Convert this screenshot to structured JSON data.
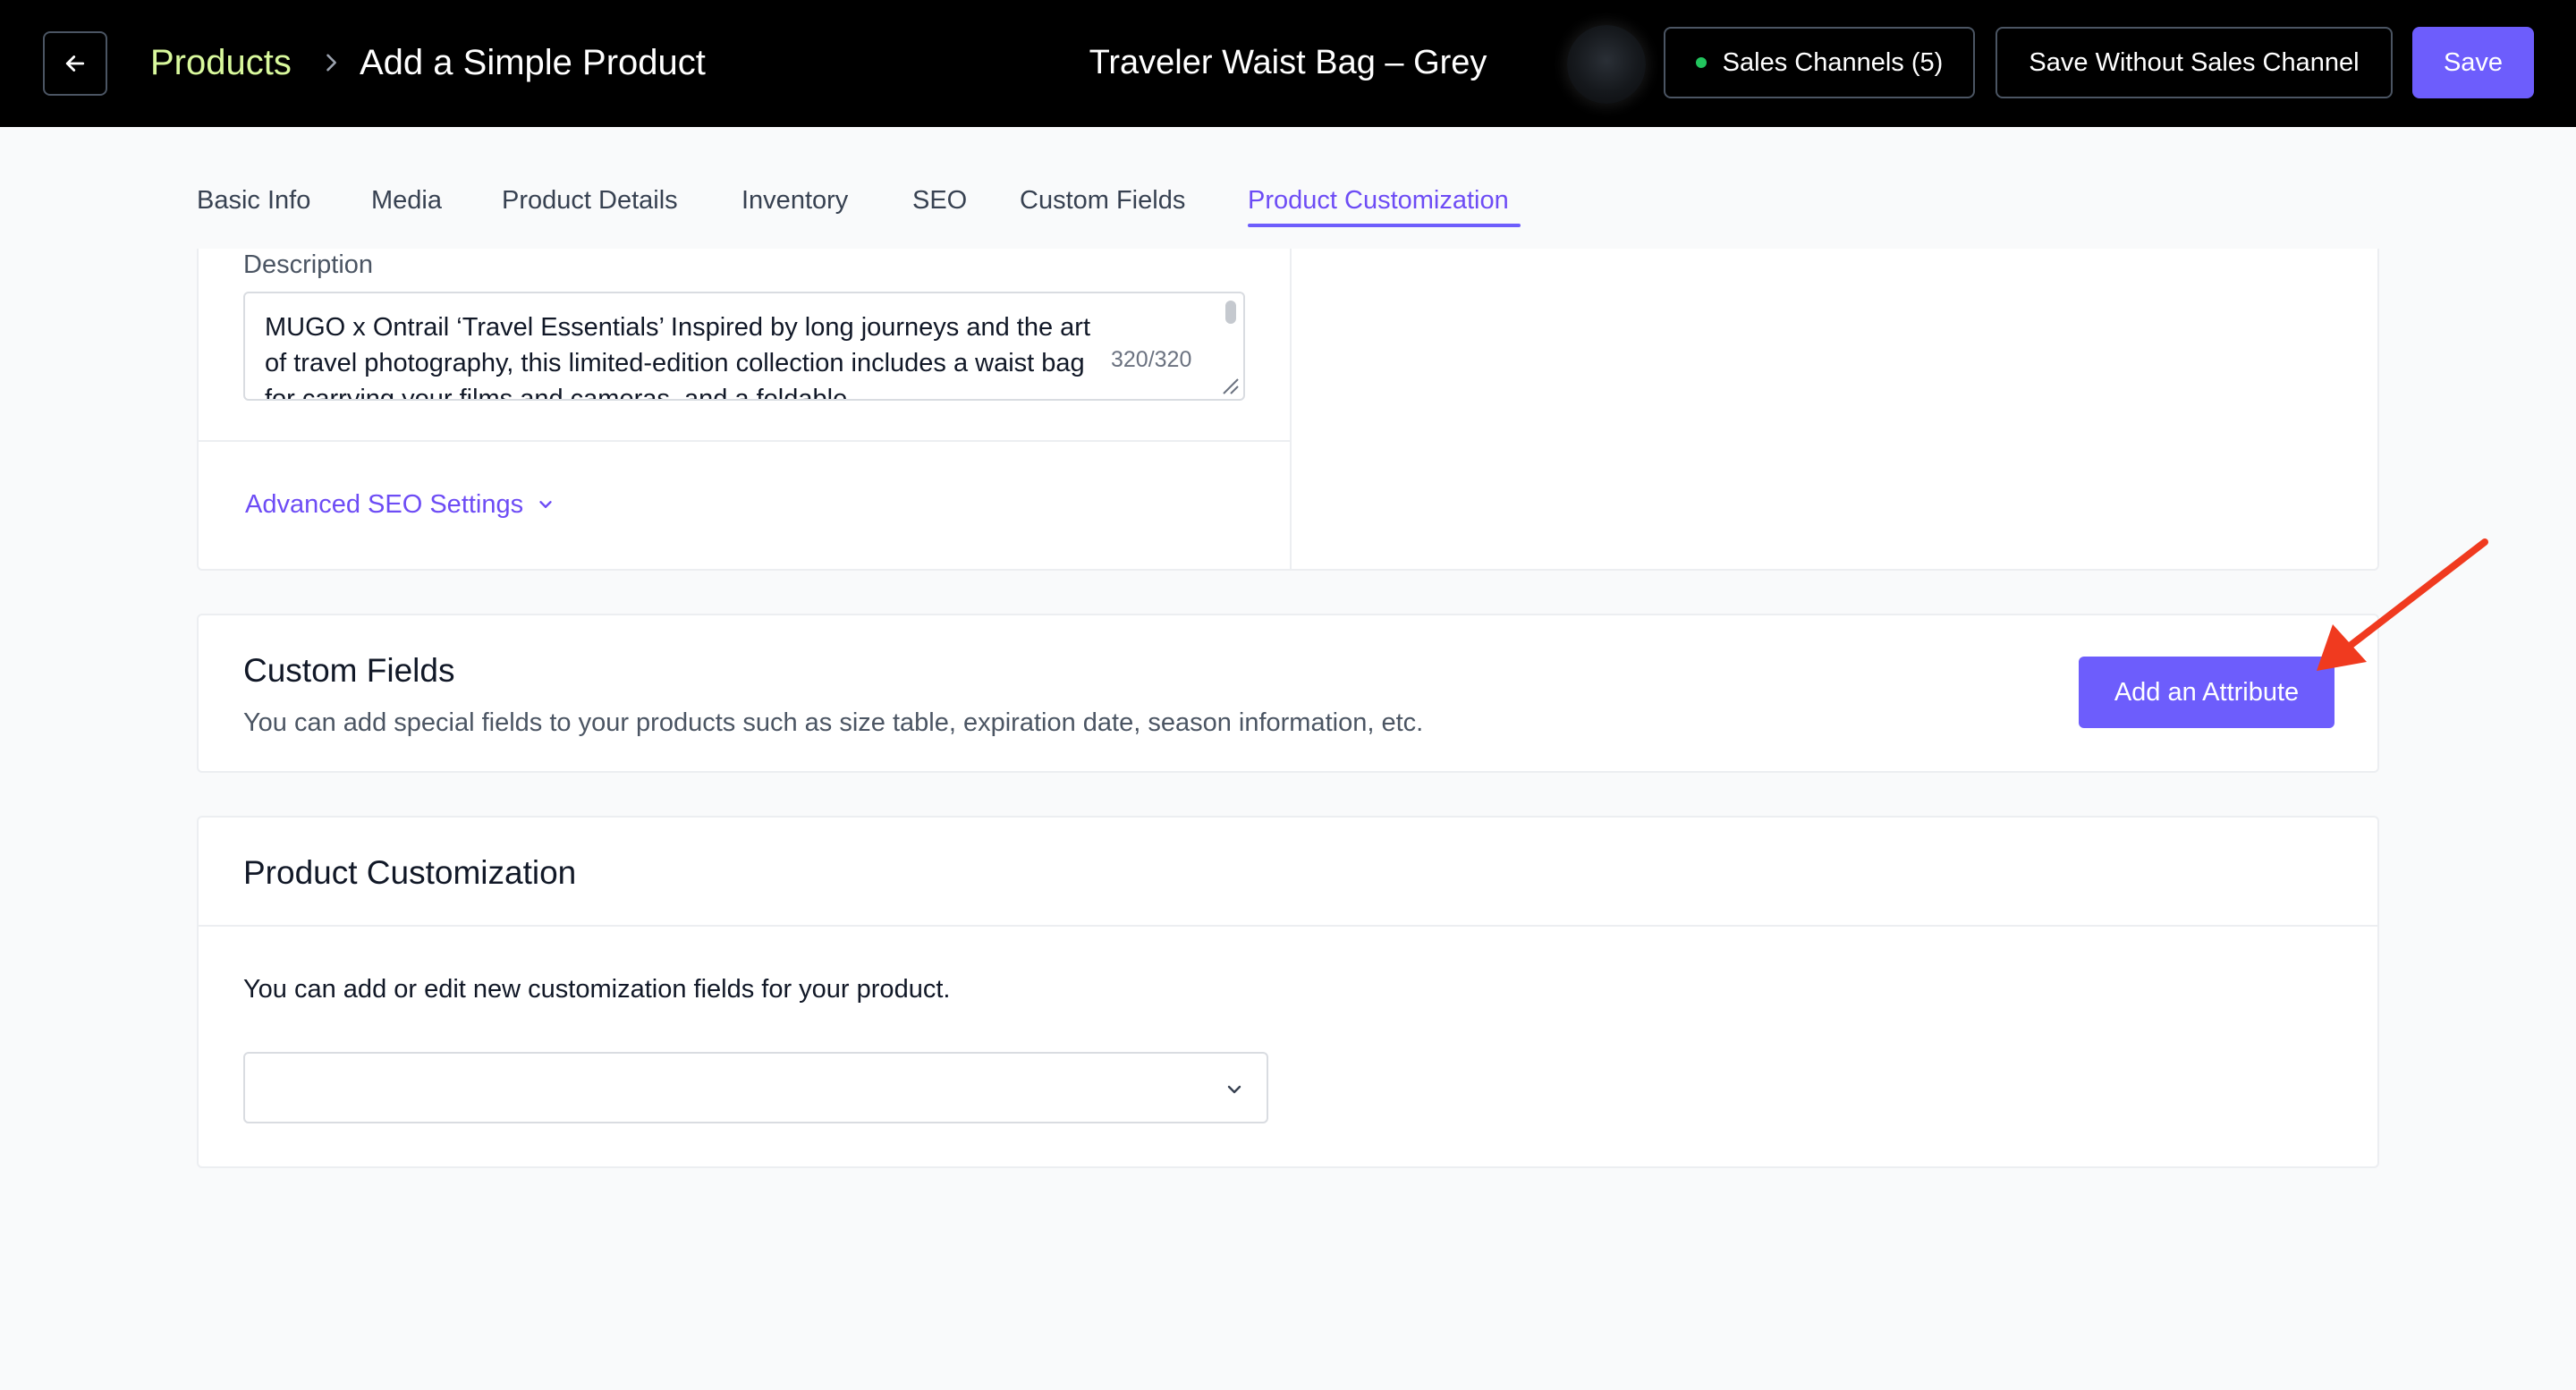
{
  "header": {
    "breadcrumb_root": "Products",
    "breadcrumb_current": "Add a Simple Product",
    "product_title": "Traveler Waist Bag – Grey",
    "sales_channels_label": "Sales Channels (5)",
    "save_without_channel_label": "Save Without Sales Channel",
    "save_label": "Save"
  },
  "tabs": [
    {
      "label": "Basic Info"
    },
    {
      "label": "Media"
    },
    {
      "label": "Product Details"
    },
    {
      "label": "Inventory"
    },
    {
      "label": "SEO"
    },
    {
      "label": "Custom Fields"
    },
    {
      "label": "Product Customization",
      "active": true
    }
  ],
  "seo": {
    "description_label": "Description",
    "description_value": "MUGO x Ontrail ‘Travel Essentials’ Inspired by long journeys and the art of travel photography, this limited-edition collection includes a waist bag for carrying your films and cameras, and a foldable",
    "char_count": "320/320",
    "advanced_label": "Advanced SEO Settings"
  },
  "custom_fields": {
    "title": "Custom Fields",
    "subtitle": "You can add special fields to your products such as size table, expiration date, season information, etc.",
    "add_button_label": "Add an Attribute"
  },
  "product_customization": {
    "title": "Product Customization",
    "subtitle": "You can add or edit new customization fields for your product.",
    "select_value": ""
  },
  "colors": {
    "accent": "#6d5dfc",
    "breadcrumb_link": "#d9f99d",
    "status_dot": "#22c55e",
    "annotation_arrow": "#f03a1f"
  },
  "icons": {
    "back": "arrow-left-icon",
    "breadcrumb_separator": "chevron-right-icon",
    "advanced_toggle": "chevron-down-icon",
    "select_toggle": "chevron-down-icon",
    "annotation": "red-arrow-annotation"
  }
}
